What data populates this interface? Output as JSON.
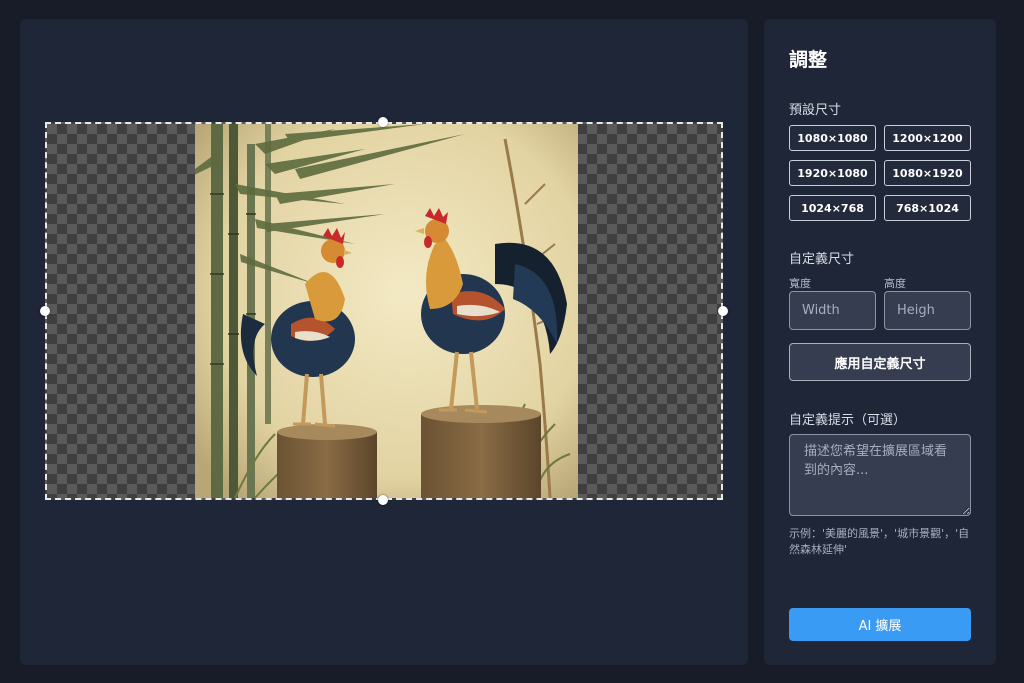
{
  "editor": {
    "canvas": {
      "image_alt": "Two roosters standing on tree stumps beside bamboo"
    }
  },
  "panel": {
    "title": "調整",
    "presets": {
      "label": "預設尺寸",
      "sizes": [
        "1080×1080",
        "1200×1200",
        "1920×1080",
        "1080×1920",
        "1024×768",
        "768×1024"
      ]
    },
    "custom_size": {
      "label": "自定義尺寸",
      "width_label": "寬度",
      "width_placeholder": "Width",
      "width_value": "",
      "height_label": "高度",
      "height_placeholder": "Heigh",
      "height_value": "",
      "apply_label": "應用自定義尺寸"
    },
    "prompt": {
      "label": "自定義提示（可選）",
      "placeholder": "描述您希望在擴展區域看到的內容...",
      "value": "",
      "hint": "示例：'美麗的風景'，'城市景觀'，'自然森林延伸'"
    },
    "ai_button_label": "AI 擴展"
  },
  "colors": {
    "background": "#171c28",
    "panel": "#1f2638",
    "accent": "#3a9bf5"
  }
}
